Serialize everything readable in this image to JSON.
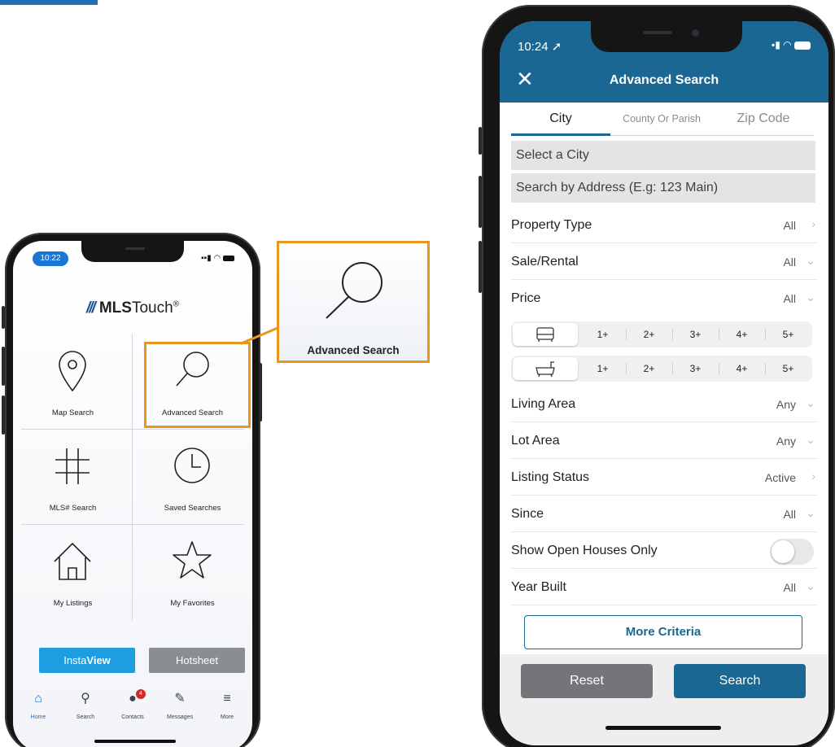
{
  "colors": {
    "accent_orange": "#e8961e",
    "header_blue": "#1b6793",
    "insta_blue": "#1e9de0",
    "hotsheet_gray": "#8a8d92",
    "reset_gray": "#737579"
  },
  "left_phone": {
    "status_time": "10:22",
    "logo": {
      "brand": "MLS",
      "suffix": "Touch",
      "mark": "®",
      "icon": "mls-stripes-logo"
    },
    "tiles": [
      {
        "label": "Map Search",
        "icon": "map-pin-icon"
      },
      {
        "label": "Advanced Search",
        "icon": "magnifier-icon"
      },
      {
        "label": "MLS# Search",
        "icon": "hashtag-icon"
      },
      {
        "label": "Saved Searches",
        "icon": "clock-icon"
      },
      {
        "label": "My Listings",
        "icon": "house-icon"
      },
      {
        "label": "My Favorites",
        "icon": "star-icon"
      }
    ],
    "insta": {
      "prefix": "Insta",
      "bold": "View"
    },
    "hotsheet": "Hotsheet",
    "tabs": [
      {
        "label": "Home",
        "icon": "home-icon"
      },
      {
        "label": "Search",
        "icon": "search-map-icon"
      },
      {
        "label": "Contacts",
        "icon": "contacts-icon",
        "badge": "4"
      },
      {
        "label": "Messages",
        "icon": "messages-icon"
      },
      {
        "label": "More",
        "icon": "menu-icon"
      }
    ]
  },
  "callout": {
    "label": "Advanced Search",
    "icon": "magnifier-icon"
  },
  "right_phone": {
    "status_time": "10:24",
    "title": "Advanced Search",
    "segments": [
      "City",
      "County Or Parish",
      "Zip Code"
    ],
    "selected_segment": "City",
    "city_placeholder": "Select a City",
    "address_placeholder": "Search by Address (E.g: 123 Main)",
    "rows_top": [
      {
        "label": "Property Type",
        "value": "All",
        "chevron": "›"
      },
      {
        "label": "Sale/Rental",
        "value": "All",
        "chevron": "⌄"
      },
      {
        "label": "Price",
        "value": "All",
        "chevron": "⌄"
      }
    ],
    "bed_options": [
      "1+",
      "2+",
      "3+",
      "4+",
      "5+"
    ],
    "bath_options": [
      "1+",
      "2+",
      "3+",
      "4+",
      "5+"
    ],
    "rows_bottom": [
      {
        "label": "Living Area",
        "value": "Any",
        "chevron": "⌄"
      },
      {
        "label": "Lot Area",
        "value": "Any",
        "chevron": "⌄"
      },
      {
        "label": "Listing Status",
        "value": "Active",
        "chevron": "›"
      },
      {
        "label": "Since",
        "value": "All",
        "chevron": "⌄"
      }
    ],
    "open_houses_label": "Show Open Houses Only",
    "open_houses_on": false,
    "year_built": {
      "label": "Year Built",
      "value": "All",
      "chevron": "⌄"
    },
    "more_criteria": "More Criteria",
    "reset": "Reset",
    "search": "Search"
  }
}
